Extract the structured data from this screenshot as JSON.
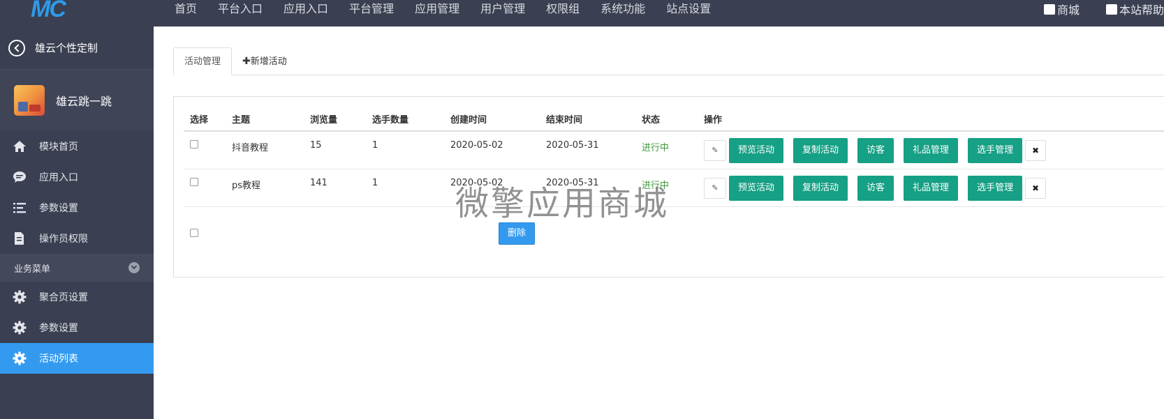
{
  "brand": {
    "logo": "MC"
  },
  "topnav": {
    "items": [
      "首页",
      "平台入口",
      "应用入口",
      "平台管理",
      "应用管理",
      "用户管理",
      "权限组",
      "系统功能",
      "站点设置"
    ],
    "shop": "商城",
    "help": "本站帮助"
  },
  "sidebar": {
    "back_label": "雄云个性定制",
    "app_name": "雄云跳一跳",
    "items": [
      {
        "label": "模块首页",
        "icon": "home-icon"
      },
      {
        "label": "应用入口",
        "icon": "chat-icon"
      },
      {
        "label": "参数设置",
        "icon": "list-icon"
      },
      {
        "label": "操作员权限",
        "icon": "document-icon"
      }
    ],
    "section": "业务菜单",
    "section_items": [
      {
        "label": "聚合页设置",
        "icon": "gear-icon"
      },
      {
        "label": "参数设置",
        "icon": "gear-icon"
      },
      {
        "label": "活动列表",
        "icon": "gear-icon",
        "active": true
      }
    ]
  },
  "tabs": {
    "manage": "活动管理",
    "add": "新增活动"
  },
  "table": {
    "headers": [
      "选择",
      "主题",
      "浏览量",
      "选手数量",
      "创建时间",
      "结束时间",
      "状态",
      "操作"
    ],
    "rows": [
      {
        "topic": "抖音教程",
        "views": "15",
        "count": "1",
        "created": "2020-05-02",
        "end": "2020-05-31",
        "status": "进行中"
      },
      {
        "topic": "ps教程",
        "views": "141",
        "count": "1",
        "created": "2020-05-02",
        "end": "2020-05-31",
        "status": "进行中"
      }
    ],
    "actions": [
      "预览活动",
      "复制活动",
      "访客",
      "礼品管理",
      "选手管理"
    ],
    "delete_label": "删除"
  },
  "watermark": "微擎应用商城",
  "colors": {
    "topbar": "#3a3f51",
    "accent": "#349af0",
    "action_green": "#16a085",
    "status_green": "#3c9b3c"
  }
}
